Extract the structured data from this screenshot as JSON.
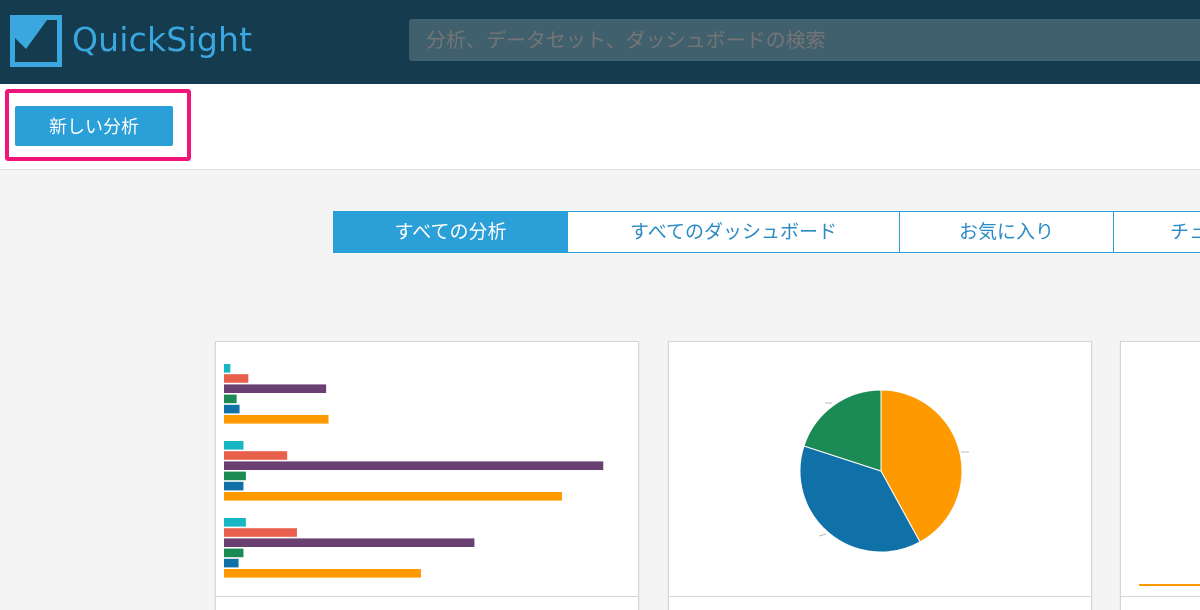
{
  "app": {
    "name": "QuickSight",
    "brand_color": "#3aa8df",
    "header_color": "#153b4e"
  },
  "search": {
    "placeholder": "分析、データセット、ダッシュボードの検索"
  },
  "toolbar": {
    "new_analysis_label": "新しい分析",
    "highlight_color": "#f0157a"
  },
  "tabs": [
    {
      "label": "すべての分析",
      "active": true
    },
    {
      "label": "すべてのダッシュボード",
      "active": false
    },
    {
      "label": "お気に入り",
      "active": false
    },
    {
      "label": "チュ",
      "active": false
    }
  ],
  "chart_data": [
    {
      "type": "bar",
      "orientation": "horizontal",
      "categories": [
        "",
        "",
        ""
      ],
      "series": [
        {
          "color": "#17b6c3",
          "values": [
            1.3,
            4,
            4.5
          ]
        },
        {
          "color": "#e8604c",
          "values": [
            5,
            13,
            15
          ]
        },
        {
          "color": "#6a4073",
          "values": [
            21,
            78,
            51.5
          ]
        },
        {
          "color": "#1c8a55",
          "values": [
            2.6,
            4.5,
            4
          ]
        },
        {
          "color": "#1071a8",
          "values": [
            3.2,
            4,
            3
          ]
        },
        {
          "color": "#ff9900",
          "values": [
            21.5,
            69.5,
            40.5
          ]
        }
      ],
      "xlim": [
        0,
        80
      ]
    },
    {
      "type": "pie",
      "slices": [
        {
          "value": 42,
          "color": "#ff9900"
        },
        {
          "value": 38,
          "color": "#1071a8"
        },
        {
          "value": 20,
          "color": "#1c8a55"
        }
      ]
    },
    {
      "type": "line",
      "series": [
        {
          "color": "#ff9900",
          "values": [
            0,
            0
          ]
        }
      ]
    }
  ]
}
